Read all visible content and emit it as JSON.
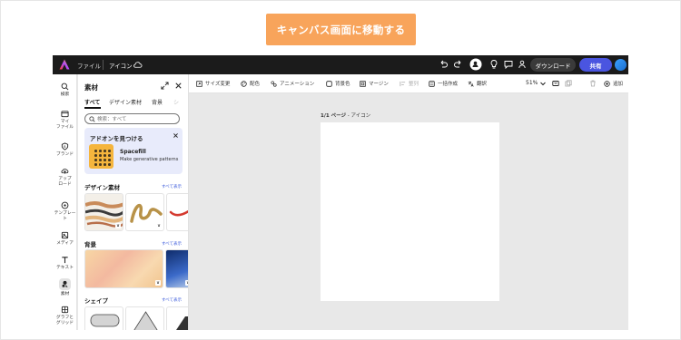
{
  "callout": {
    "text": "キャンバス画面に移動する"
  },
  "topbar": {
    "menu_file": "ファイル",
    "doc_title": "アイコン",
    "download_label": "ダウンロード",
    "share_label": "共有"
  },
  "rail": {
    "items": [
      {
        "label": "検索"
      },
      {
        "label": "マイ\nファイル"
      },
      {
        "label": "ブランド"
      },
      {
        "label": "アップ\nロード"
      },
      {
        "label": "テンプレー\nト"
      },
      {
        "label": "メディア"
      },
      {
        "label": "テキスト"
      },
      {
        "label": "素材"
      },
      {
        "label": "グラフと\nグリッド"
      }
    ]
  },
  "panel": {
    "title": "素材",
    "tabs": [
      "すべて",
      "デザイン素材",
      "背景"
    ],
    "search_placeholder": "検索：すべて",
    "promo": {
      "heading": "アドオンを見つける",
      "addon_name": "Spacefill",
      "addon_desc": "Make generative patterns"
    },
    "sections": [
      {
        "title": "デザイン素材",
        "link": "すべて表示"
      },
      {
        "title": "背景",
        "link": "すべて表示"
      },
      {
        "title": "シェイプ",
        "link": "すべて表示"
      }
    ]
  },
  "toolbar": {
    "resize": "サイズ変更",
    "color": "配色",
    "animation": "アニメーション",
    "bg_color": "背景色",
    "margin": "マージン",
    "align": "整列",
    "bulk": "一括作成",
    "translate": "翻訳",
    "zoom": "51%",
    "add": "追加"
  },
  "canvas": {
    "page_indicator": "1/1 ページ",
    "page_name": " - アイコン"
  },
  "colors": {
    "accent": "#f8a45b",
    "share_button": "#4a55e0",
    "topbar_bg": "#1b1b1b",
    "promo_bg": "#e8ebfb"
  }
}
